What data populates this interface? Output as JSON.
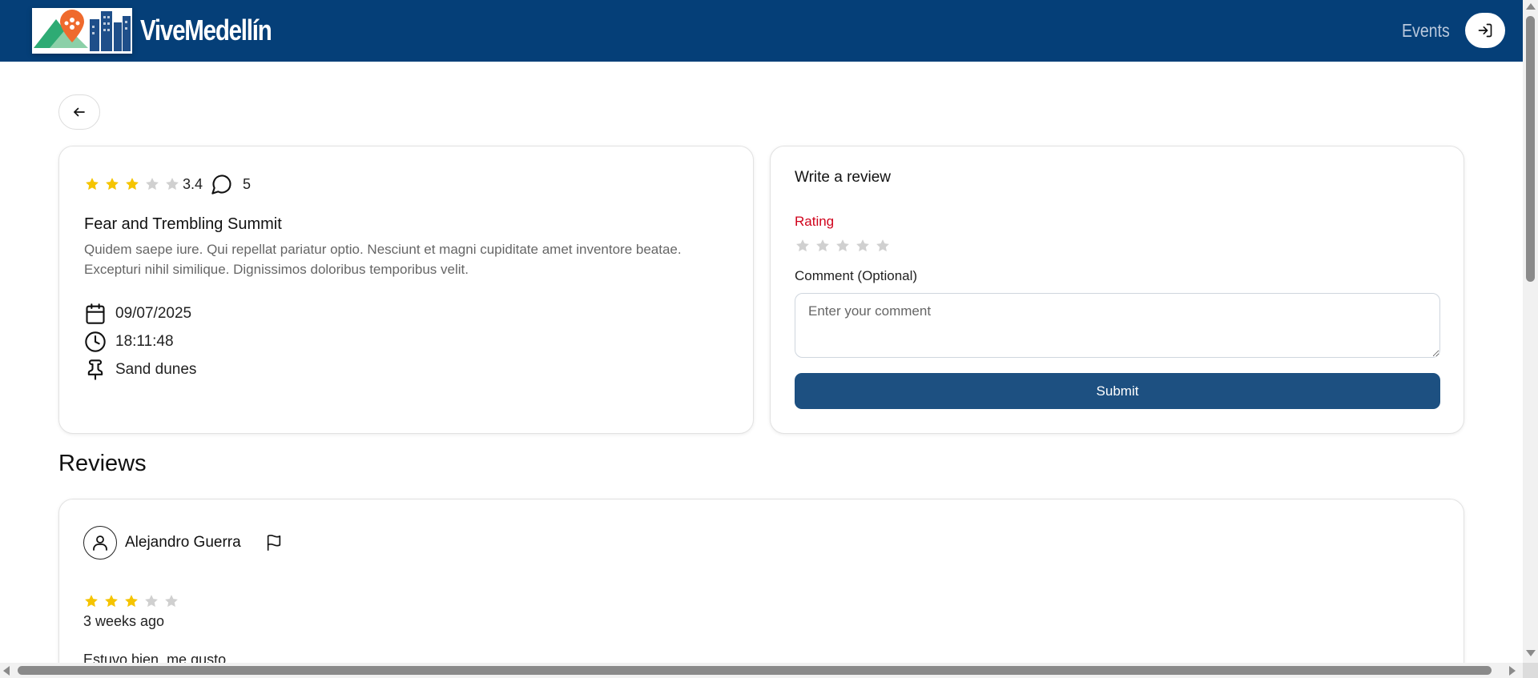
{
  "header": {
    "brand": "ViveMedellín",
    "nav_events": "Events",
    "login_icon": "login-icon",
    "background": "#053f78"
  },
  "event": {
    "rating_stars": 3,
    "average_rating": "3.4",
    "comment_count": "5",
    "title": "Fear and Trembling Summit",
    "description": "Quidem saepe iure. Qui repellat pariatur optio. Nesciunt et magni cupiditate amet inventore beatae. Excepturi nihil similique. Dignissimos doloribus temporibus velit.",
    "date": "09/07/2025",
    "time": "18:11:48",
    "location": "Sand dunes"
  },
  "review_form": {
    "title": "Write a review",
    "rating_label": "Rating",
    "comment_label": "Comment (Optional)",
    "comment_placeholder": "Enter your comment",
    "submit_label": "Submit",
    "submit_color": "#1d5081",
    "rating_label_color": "#d0021b"
  },
  "reviews": {
    "heading": "Reviews",
    "items": [
      {
        "author": "Alejandro Guerra",
        "stars": 3,
        "time_ago": "3 weeks ago",
        "text": "Estuvo bien, me gusto."
      }
    ]
  },
  "colors": {
    "star_filled": "#f5c400",
    "star_empty": "#d0d0d0"
  }
}
